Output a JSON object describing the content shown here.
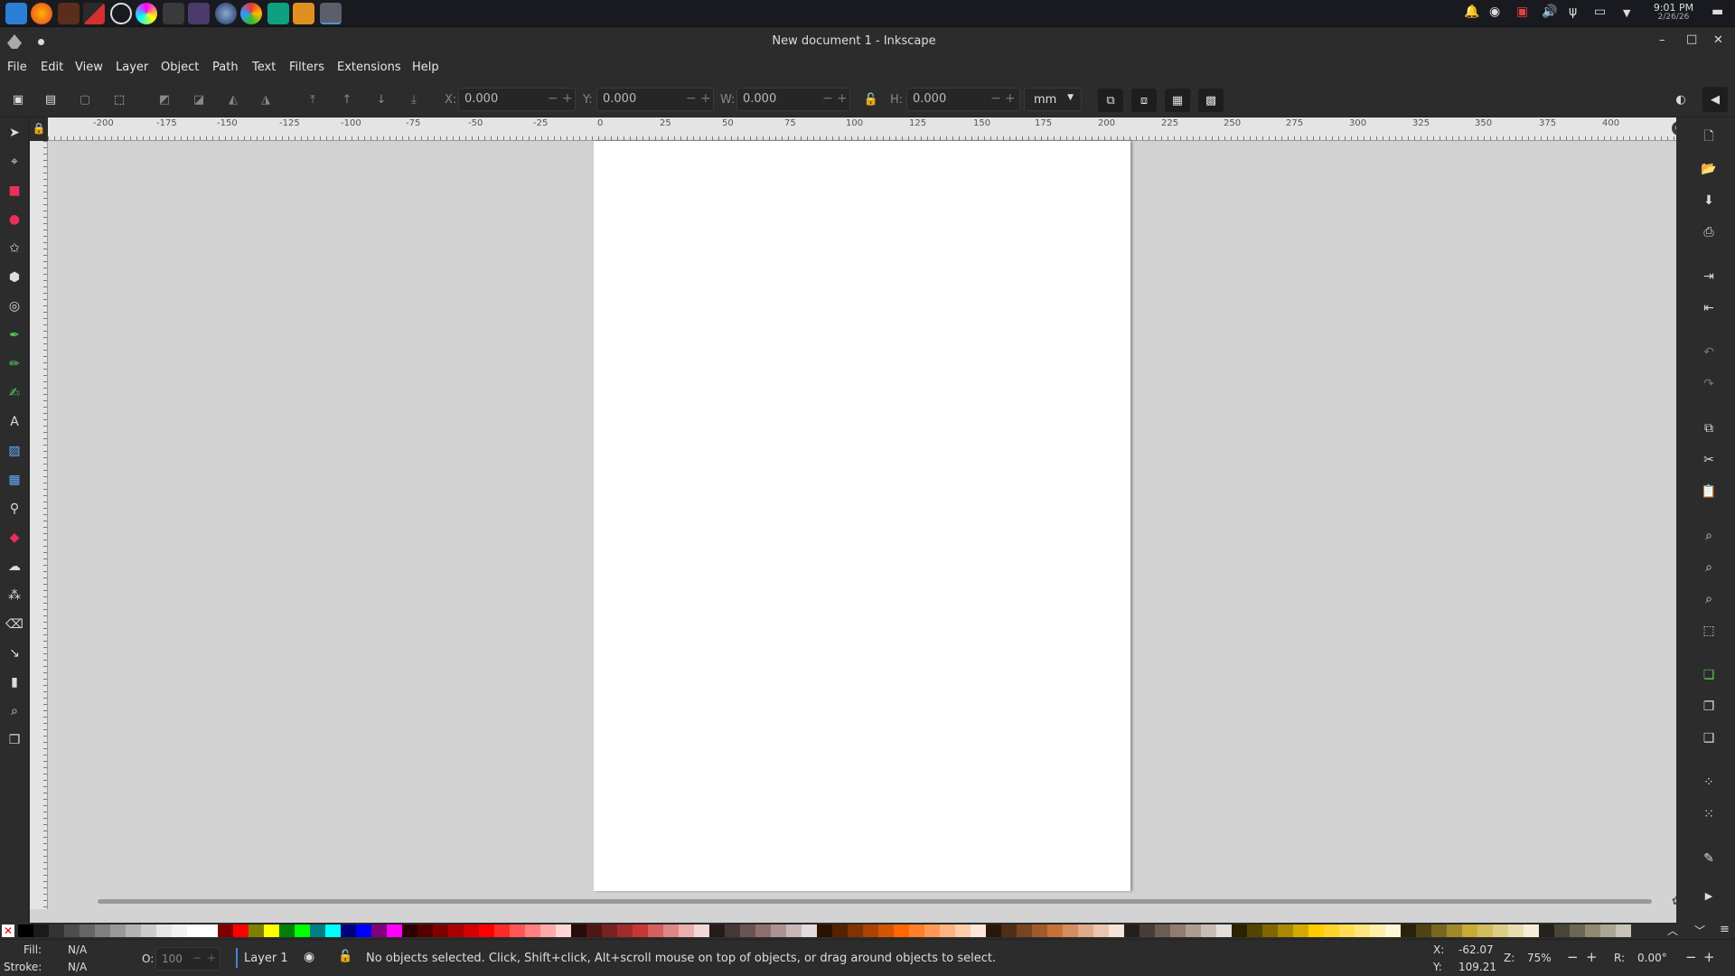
{
  "taskbar": {
    "apps": [
      "start-icon",
      "firefox-icon",
      "app-icon",
      "affinity-icon",
      "chromium-icon",
      "color-picker-icon",
      "terminal-icon",
      "grid-app-icon",
      "circle-app-icon",
      "palette-icon",
      "vpn-icon",
      "brush-icon",
      "inkscape-icon"
    ],
    "clock_time": "9:01 PM",
    "clock_date": "2/26/26"
  },
  "window": {
    "title": "New document 1 - Inkscape",
    "minimize": "–",
    "maximize": "□",
    "close": "✕"
  },
  "menu": [
    "File",
    "Edit",
    "View",
    "Layer",
    "Object",
    "Path",
    "Text",
    "Filters",
    "Extensions",
    "Help"
  ],
  "toolbar": {
    "x_label": "X:",
    "x_value": "0.000",
    "y_label": "Y:",
    "y_value": "0.000",
    "w_label": "W:",
    "w_value": "0.000",
    "h_label": "H:",
    "h_value": "0.000",
    "unit": "mm"
  },
  "ruler": {
    "h_ticks": [
      "-200",
      "-175",
      "-150",
      "-125",
      "-100",
      "-75",
      "-50",
      "-25",
      "0",
      "25",
      "50",
      "75",
      "100",
      "125",
      "150",
      "175",
      "200",
      "225",
      "250",
      "275",
      "300",
      "325",
      "350",
      "375",
      "400"
    ]
  },
  "status": {
    "fill_label": "Fill:",
    "fill_value": "N/A",
    "stroke_label": "Stroke:",
    "stroke_value": "N/A",
    "opacity_label": "O:",
    "opacity_value": "100",
    "layer": "Layer 1",
    "message": "No objects selected. Click, Shift+click, Alt+scroll mouse on top of objects, or drag around objects to select.",
    "cursor_x_label": "X:",
    "cursor_x": "-62.07",
    "cursor_y_label": "Y:",
    "cursor_y": "109.21",
    "zoom_label": "Z:",
    "zoom": "75%",
    "rotate_label": "R:",
    "rotate": "0.00°"
  },
  "palette": [
    "#000000",
    "#1a1a1a",
    "#333333",
    "#4d4d4d",
    "#666666",
    "#808080",
    "#999999",
    "#b3b3b3",
    "#cccccc",
    "#e6e6e6",
    "#f2f2f2",
    "#ffffff",
    "#ffffff",
    "#800000",
    "#ff0000",
    "#808000",
    "#ffff00",
    "#008000",
    "#00ff00",
    "#008080",
    "#00ffff",
    "#000080",
    "#0000ff",
    "#800080",
    "#ff00ff",
    "#2b0000",
    "#550000",
    "#800000",
    "#aa0000",
    "#d40000",
    "#ff0000",
    "#ff2a2a",
    "#ff5555",
    "#ff8080",
    "#ffaaaa",
    "#ffd5d5",
    "#280b0b",
    "#501616",
    "#782121",
    "#a02c2c",
    "#c83737",
    "#d35f5f",
    "#de8787",
    "#e9afaf",
    "#f4d7d7",
    "#241c1c",
    "#483737",
    "#6c5353",
    "#916f6f",
    "#ac9393",
    "#c8b7b7",
    "#e3dbdb",
    "#2b1100",
    "#552200",
    "#803300",
    "#aa4400",
    "#d45500",
    "#ff6600",
    "#ff7f2a",
    "#ff9955",
    "#ffb380",
    "#ffccaa",
    "#ffe6d5",
    "#28170b",
    "#502d16",
    "#784421",
    "#a05a2c",
    "#c87137",
    "#d38d5f",
    "#deaa87",
    "#e9c6af",
    "#f4e3d7",
    "#241f1c",
    "#483e37",
    "#6c5d53",
    "#917c6f",
    "#ac9d93",
    "#c8beb7",
    "#e3dedb",
    "#2b2200",
    "#554400",
    "#806600",
    "#aa8800",
    "#d4aa00",
    "#ffcc00",
    "#ffd42a",
    "#ffdd55",
    "#ffe680",
    "#ffeeaa",
    "#fff6d5",
    "#28220b",
    "#504416",
    "#786721",
    "#a0892c",
    "#c8ab37",
    "#d3bc5f",
    "#decd87",
    "#e9ddaf",
    "#f4eed7",
    "#24221c",
    "#484537",
    "#6c6753",
    "#918a6f",
    "#aca793",
    "#c8c4b7"
  ]
}
